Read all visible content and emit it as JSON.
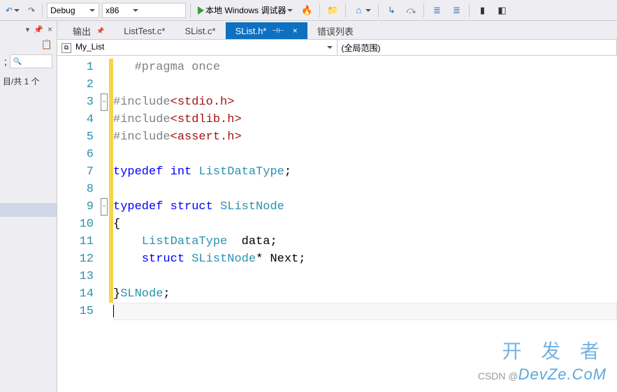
{
  "toolbar": {
    "undo_icon": "↶",
    "redo_icon": "↷",
    "config_label": "Debug",
    "platform_label": "x86",
    "debug_button": "本地 Windows 调试器",
    "icons": {
      "flame": "🔥",
      "folder": "📁",
      "home": "⌂",
      "arrow_in": "↳",
      "step_over": "⤼",
      "step_into": "⤵",
      "toggle1": "≣",
      "toggle2": "≣",
      "bookmark": "▮",
      "bookmark_nav": "◧"
    }
  },
  "left_panel": {
    "status": "目/共 1 个",
    "copy_icon": "📋"
  },
  "tabs": [
    {
      "label": "输出",
      "modified": false,
      "pinned": true
    },
    {
      "label": "ListTest.c*",
      "modified": true
    },
    {
      "label": "SList.c*",
      "modified": true
    },
    {
      "label": "SList.h*",
      "modified": true,
      "active": true,
      "pinned": true
    },
    {
      "label": "错误列表",
      "modified": false
    }
  ],
  "navbar": {
    "left": "My_List",
    "right": "(全局范围)"
  },
  "code_lines": [
    {
      "n": 1,
      "yellow": true,
      "fold": "",
      "tokens": [
        {
          "c": "pp",
          "t": "   #pragma once"
        }
      ]
    },
    {
      "n": 2,
      "yellow": true,
      "fold": "",
      "tokens": []
    },
    {
      "n": 3,
      "yellow": true,
      "fold": "minus",
      "tokens": [
        {
          "c": "pp",
          "t": "#include"
        },
        {
          "c": "str",
          "t": "<stdio.h>"
        }
      ]
    },
    {
      "n": 4,
      "yellow": true,
      "fold": "",
      "tokens": [
        {
          "c": "pp",
          "t": "#include"
        },
        {
          "c": "str",
          "t": "<stdlib.h>"
        }
      ]
    },
    {
      "n": 5,
      "yellow": true,
      "fold": "",
      "tokens": [
        {
          "c": "pp",
          "t": "#include"
        },
        {
          "c": "str",
          "t": "<assert.h>"
        }
      ]
    },
    {
      "n": 6,
      "yellow": true,
      "fold": "",
      "tokens": []
    },
    {
      "n": 7,
      "yellow": true,
      "fold": "",
      "tokens": [
        {
          "c": "kw",
          "t": "typedef"
        },
        {
          "c": "txt",
          "t": " "
        },
        {
          "c": "kw",
          "t": "int"
        },
        {
          "c": "txt",
          "t": " "
        },
        {
          "c": "type",
          "t": "ListDataType"
        },
        {
          "c": "txt",
          "t": ";"
        }
      ]
    },
    {
      "n": 8,
      "yellow": true,
      "fold": "",
      "tokens": []
    },
    {
      "n": 9,
      "yellow": true,
      "fold": "minus",
      "tokens": [
        {
          "c": "kw",
          "t": "typedef"
        },
        {
          "c": "txt",
          "t": " "
        },
        {
          "c": "kw",
          "t": "struct"
        },
        {
          "c": "txt",
          "t": " "
        },
        {
          "c": "type",
          "t": "SListNode"
        }
      ]
    },
    {
      "n": 10,
      "yellow": true,
      "fold": "",
      "tokens": [
        {
          "c": "txt",
          "t": "{"
        }
      ]
    },
    {
      "n": 11,
      "yellow": true,
      "fold": "",
      "tokens": [
        {
          "c": "txt",
          "t": "    "
        },
        {
          "c": "type",
          "t": "ListDataType"
        },
        {
          "c": "txt",
          "t": "  data;"
        }
      ]
    },
    {
      "n": 12,
      "yellow": true,
      "fold": "",
      "tokens": [
        {
          "c": "txt",
          "t": "    "
        },
        {
          "c": "kw",
          "t": "struct"
        },
        {
          "c": "txt",
          "t": " "
        },
        {
          "c": "type",
          "t": "SListNode"
        },
        {
          "c": "txt",
          "t": "* Next;"
        }
      ]
    },
    {
      "n": 13,
      "yellow": true,
      "fold": "",
      "tokens": []
    },
    {
      "n": 14,
      "yellow": true,
      "fold": "",
      "tokens": [
        {
          "c": "txt",
          "t": "}"
        },
        {
          "c": "type",
          "t": "SLNode"
        },
        {
          "c": "txt",
          "t": ";"
        }
      ]
    },
    {
      "n": 15,
      "yellow": false,
      "fold": "",
      "tokens": [],
      "cursor": true
    }
  ],
  "watermark": {
    "line1": "开 发 者",
    "prefix": "CSDN @",
    "brand": "DevZe.CoM"
  }
}
